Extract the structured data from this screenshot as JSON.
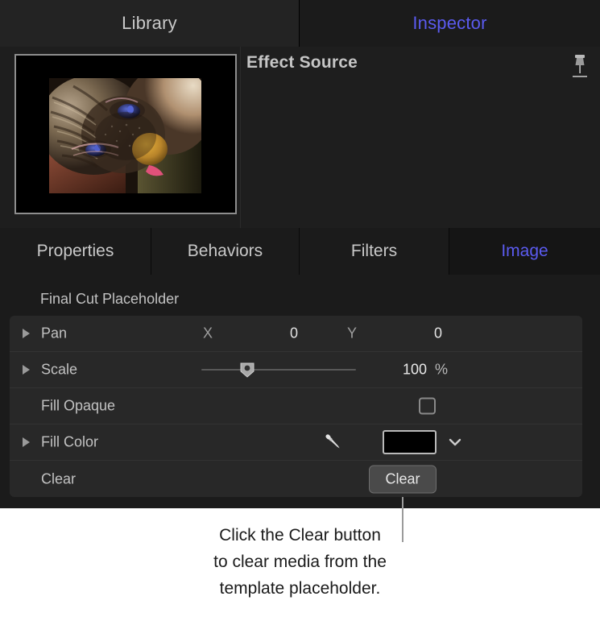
{
  "top_tabs": [
    {
      "label": "Library",
      "selected": false
    },
    {
      "label": "Inspector",
      "selected": true
    }
  ],
  "preview": {
    "title": "Effect Source",
    "pin_icon": "pushpin-icon",
    "thumbnail_alt": "cat-closeup-photo"
  },
  "sub_tabs": [
    {
      "label": "Properties",
      "selected": false
    },
    {
      "label": "Behaviors",
      "selected": false
    },
    {
      "label": "Filters",
      "selected": false
    },
    {
      "label": "Image",
      "selected": true
    }
  ],
  "params": {
    "group_title": "Final Cut Placeholder",
    "pan": {
      "label": "Pan",
      "x_label": "X",
      "x_value": "0",
      "y_label": "Y",
      "y_value": "0"
    },
    "scale": {
      "label": "Scale",
      "value": "100",
      "unit": "%",
      "slider_percent": 26
    },
    "fill_opaque": {
      "label": "Fill Opaque",
      "checked": false
    },
    "fill_color": {
      "label": "Fill Color",
      "eyedropper_icon": "eyedropper-icon",
      "swatch_color": "#000000",
      "chevron_icon": "chevron-down-icon"
    },
    "clear": {
      "label": "Clear",
      "button_label": "Clear"
    }
  },
  "callout": {
    "line1": "Click the Clear button",
    "line2": "to clear media from the",
    "line3": "template placeholder."
  },
  "colors": {
    "accent": "#5b5bf0",
    "panel_bg": "#1b1b1b",
    "row_bg": "#282828",
    "text": "#c2c2c2"
  }
}
